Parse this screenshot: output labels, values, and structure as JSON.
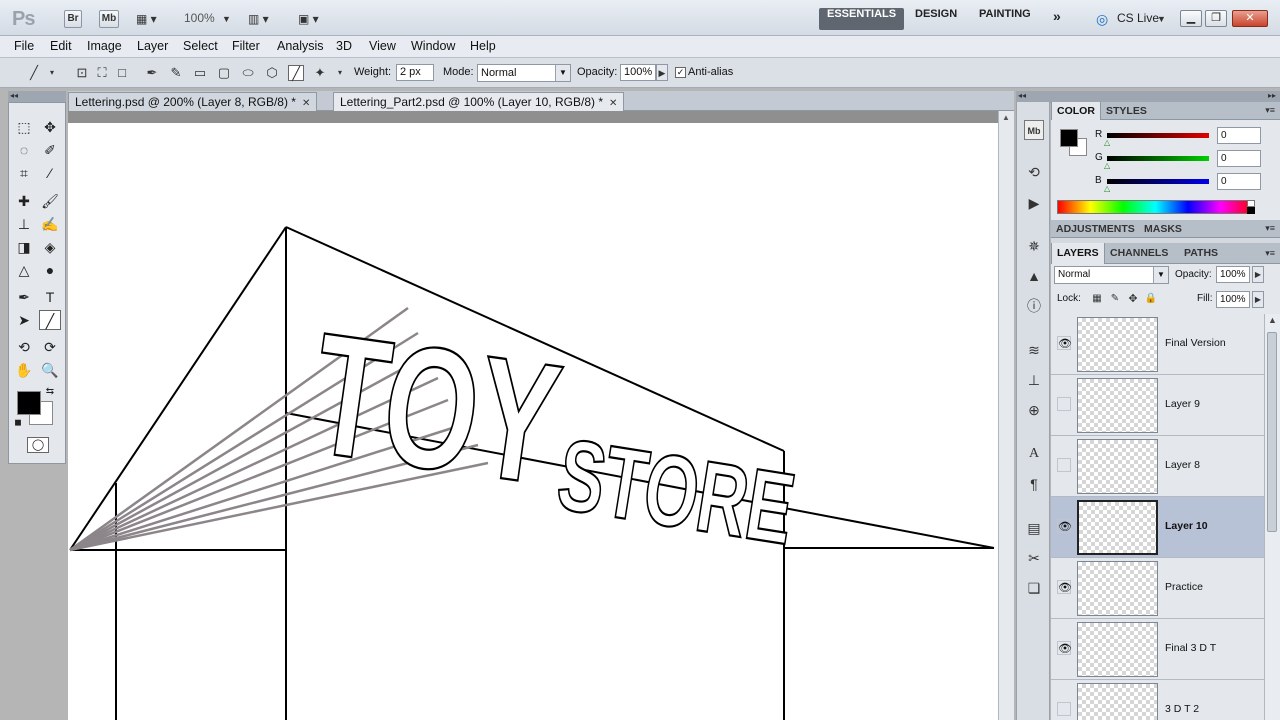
{
  "titlebar": {
    "app_logo": "Ps",
    "bridge_label": "Br",
    "minibridge_label": "Mb",
    "zoom": "100%",
    "workspaces": [
      "ESSENTIALS",
      "DESIGN",
      "PAINTING"
    ],
    "more": "»",
    "cslive": "CS Live"
  },
  "menu": [
    "File",
    "Edit",
    "Image",
    "Layer",
    "Select",
    "Filter",
    "Analysis",
    "3D",
    "View",
    "Window",
    "Help"
  ],
  "options": {
    "weight_label": "Weight:",
    "weight_value": "2 px",
    "mode_label": "Mode:",
    "mode_value": "Normal",
    "opacity_label": "Opacity:",
    "opacity_value": "100%",
    "antialias_label": "Anti-alias",
    "antialias_checked": true
  },
  "documents": [
    {
      "title": "Lettering.psd @ 200% (Layer 8, RGB/8) *",
      "active": false
    },
    {
      "title": "Lettering_Part2.psd @ 100% (Layer 10, RGB/8) *",
      "active": true
    }
  ],
  "canvas_art": {
    "words": [
      "TOY",
      "STORE"
    ]
  },
  "color_panel": {
    "tabs": [
      "COLOR",
      "STYLES"
    ],
    "channels": [
      {
        "label": "R",
        "value": "0",
        "color": "#d42020"
      },
      {
        "label": "G",
        "value": "0",
        "color": "#22b022"
      },
      {
        "label": "B",
        "value": "0",
        "color": "#1a1ad0"
      }
    ]
  },
  "adjustments_panel": {
    "tabs": [
      "ADJUSTMENTS",
      "MASKS"
    ]
  },
  "layers_panel": {
    "tabs": [
      "LAYERS",
      "CHANNELS",
      "PATHS"
    ],
    "blend_mode": "Normal",
    "opacity_label": "Opacity:",
    "opacity_value": "100%",
    "lock_label": "Lock:",
    "fill_label": "Fill:",
    "fill_value": "100%",
    "layers": [
      {
        "name": "Final Version",
        "visible": true,
        "selected": false
      },
      {
        "name": "Layer 9",
        "visible": false,
        "selected": false
      },
      {
        "name": "Layer 8",
        "visible": false,
        "selected": false
      },
      {
        "name": "Layer 10",
        "visible": true,
        "selected": true
      },
      {
        "name": "Practice",
        "visible": true,
        "selected": false
      },
      {
        "name": "Final 3 D T",
        "visible": true,
        "selected": false
      },
      {
        "name": "3 D T 2",
        "visible": false,
        "selected": false
      }
    ]
  }
}
